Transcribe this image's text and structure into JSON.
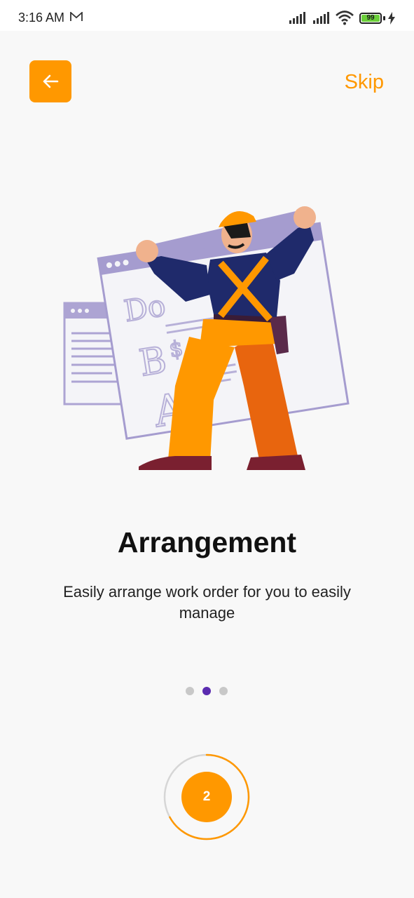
{
  "status_bar": {
    "time": "3:16 AM",
    "battery_level": "99",
    "icons": [
      "mail-icon",
      "signal-icon",
      "signal-icon",
      "wifi-icon",
      "battery-icon",
      "charging-icon"
    ]
  },
  "header": {
    "back_icon": "arrow-left-icon",
    "skip_label": "Skip"
  },
  "onboarding": {
    "title": "Arrangement",
    "description": "Easily arrange work order for you to easily manage",
    "illustration": "worker-arranging-web-pages",
    "current_page": 2,
    "total_pages": 3,
    "page_label": "2",
    "progress_fraction": 0.67
  },
  "colors": {
    "accent": "#ff9800",
    "dot_active": "#5b2cb0",
    "dot_inactive": "#c8c8c8"
  }
}
